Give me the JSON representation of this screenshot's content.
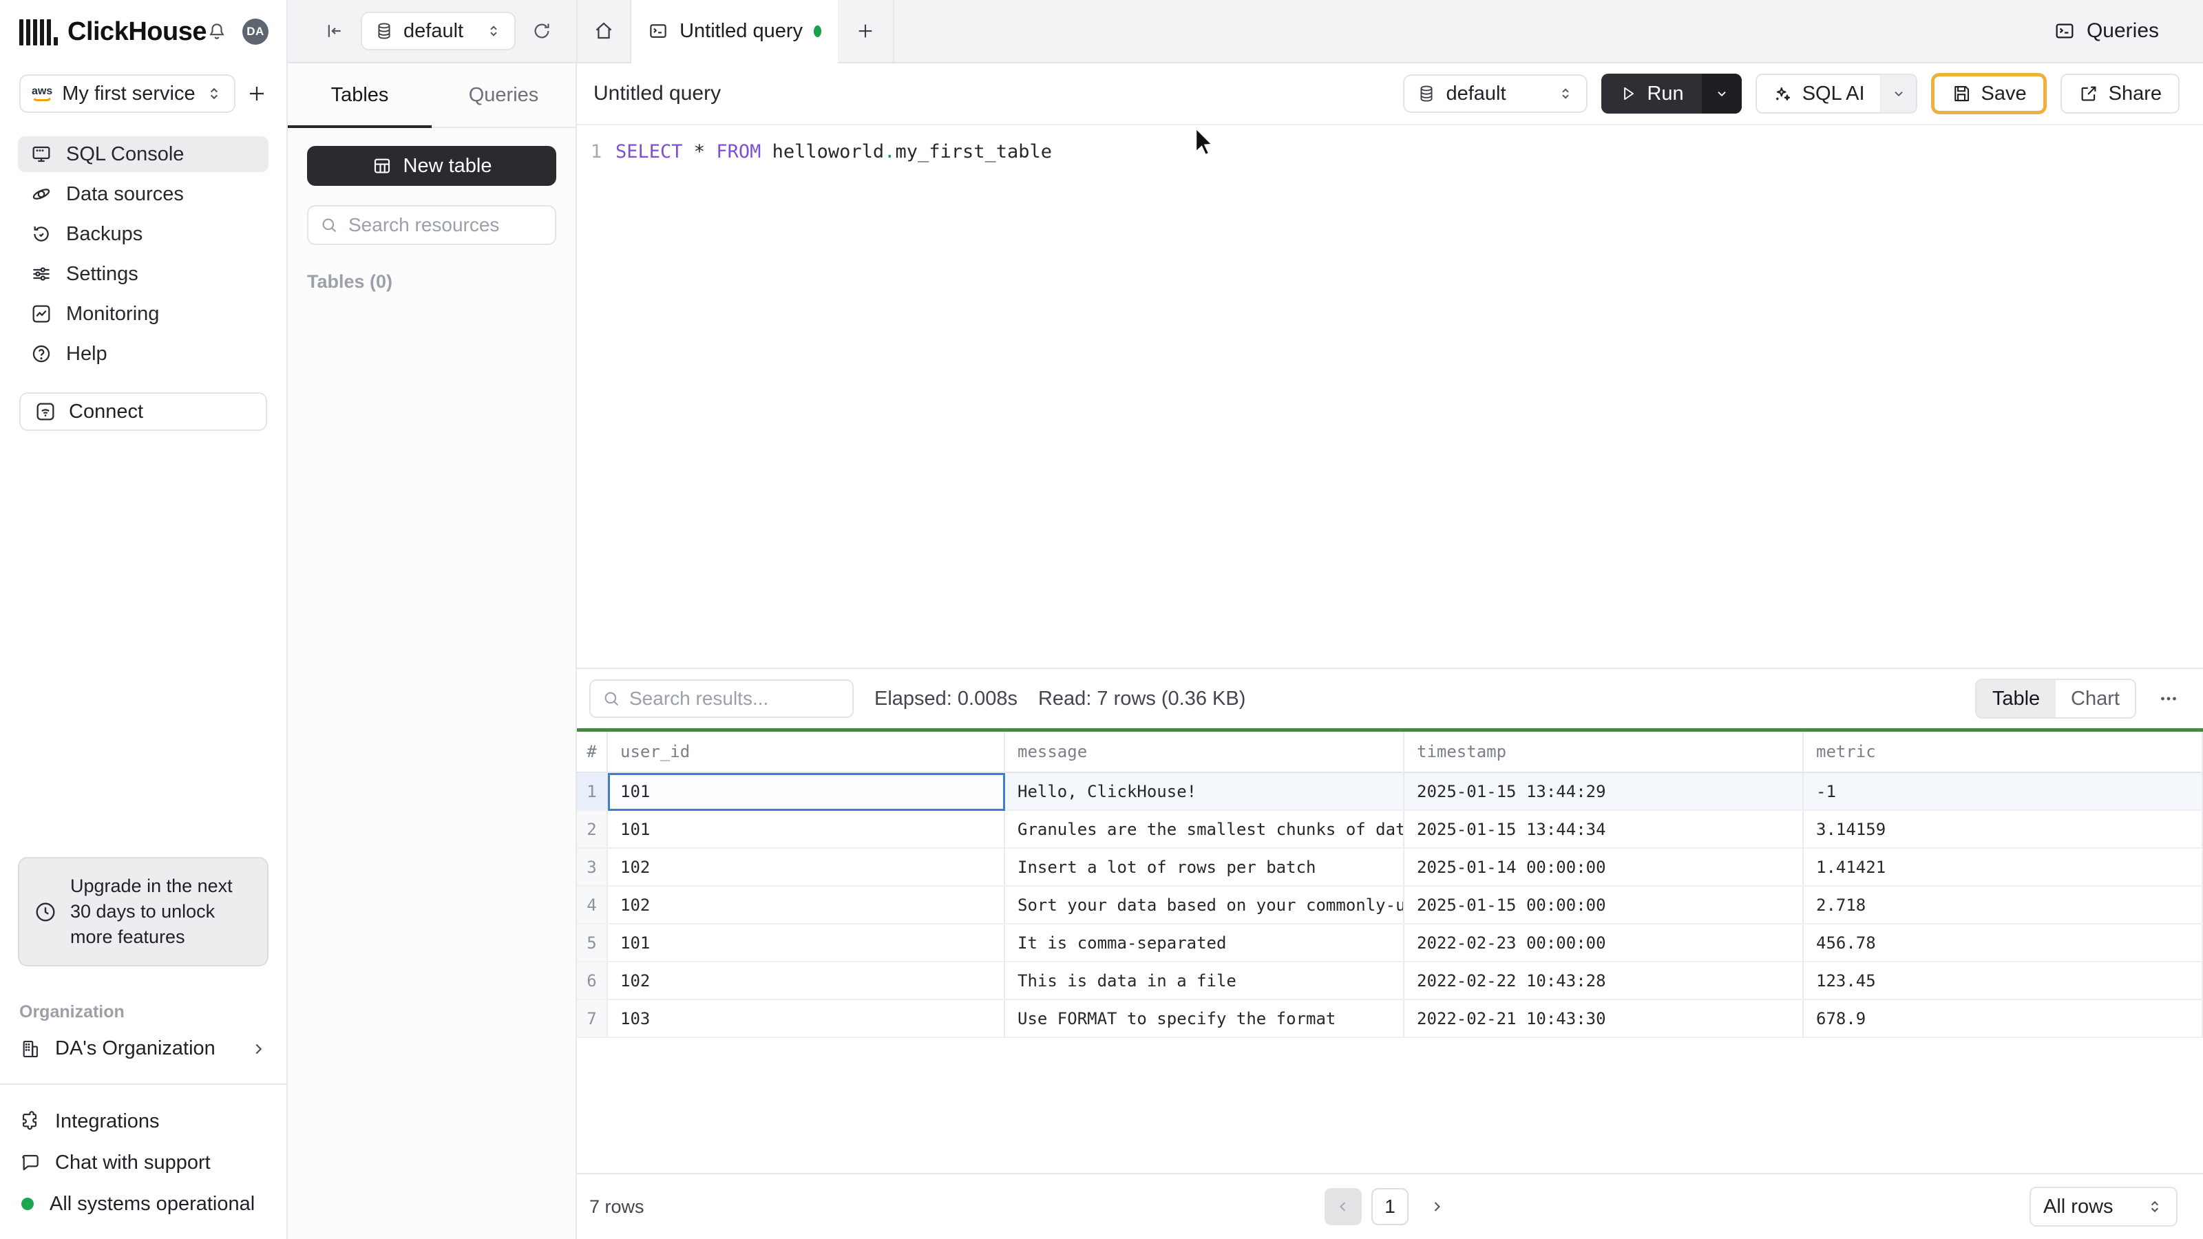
{
  "app": {
    "brand": "ClickHouse",
    "avatar_initials": "DA"
  },
  "topbar": {
    "database_selector": "default",
    "tab_title": "Untitled query",
    "queries_button": "Queries"
  },
  "sidebar": {
    "service_name": "My first service",
    "items": [
      {
        "label": "SQL Console",
        "icon": "sql-console-icon",
        "active": true
      },
      {
        "label": "Data sources",
        "icon": "data-sources-icon",
        "active": false
      },
      {
        "label": "Backups",
        "icon": "backups-icon",
        "active": false
      },
      {
        "label": "Settings",
        "icon": "settings-icon",
        "active": false
      },
      {
        "label": "Monitoring",
        "icon": "monitoring-icon",
        "active": false
      },
      {
        "label": "Help",
        "icon": "help-icon",
        "active": false
      }
    ],
    "connect_label": "Connect",
    "upgrade_notice": "Upgrade in the next 30 days to unlock more features",
    "organization_section": "Organization",
    "organization_name": "DA's Organization",
    "footer_items": [
      {
        "label": "Integrations",
        "icon": "puzzle-icon"
      },
      {
        "label": "Chat with support",
        "icon": "chat-icon"
      },
      {
        "label": "All systems operational",
        "icon": "status-dot"
      }
    ]
  },
  "resources_panel": {
    "tabs": [
      {
        "label": "Tables",
        "active": true
      },
      {
        "label": "Queries",
        "active": false
      }
    ],
    "new_table_label": "New table",
    "search_placeholder": "Search resources",
    "section_label": "Tables (0)"
  },
  "editor": {
    "title": "Untitled query",
    "line_number": "1",
    "sql": {
      "select": "SELECT",
      "star": " * ",
      "from": "FROM",
      "schema": " helloworld",
      "dot": ".",
      "table_name": "my_first_table"
    },
    "database_selector": "default",
    "run_label": "Run",
    "sql_ai_label": "SQL AI",
    "save_label": "Save",
    "share_label": "Share"
  },
  "results": {
    "search_placeholder": "Search results...",
    "elapsed": "Elapsed: 0.008s",
    "read": "Read: 7 rows (0.36 KB)",
    "view_toggle": [
      {
        "label": "Table",
        "active": true
      },
      {
        "label": "Chart",
        "active": false
      }
    ],
    "table": {
      "columns": [
        "#",
        "user_id",
        "message",
        "timestamp",
        "metric"
      ],
      "rows": [
        {
          "n": "1",
          "user_id": "101",
          "message": "Hello, ClickHouse!",
          "timestamp": "2025-01-15 13:44:29",
          "metric": "-1"
        },
        {
          "n": "2",
          "user_id": "101",
          "message": "Granules are the smallest chunks of data read",
          "timestamp": "2025-01-15 13:44:34",
          "metric": "3.14159"
        },
        {
          "n": "3",
          "user_id": "102",
          "message": "Insert a lot of rows per batch",
          "timestamp": "2025-01-14 00:00:00",
          "metric": "1.41421"
        },
        {
          "n": "4",
          "user_id": "102",
          "message": "Sort your data based on your commonly-used que…",
          "timestamp": "2025-01-15 00:00:00",
          "metric": "2.718"
        },
        {
          "n": "5",
          "user_id": "101",
          "message": "It is comma-separated",
          "timestamp": "2022-02-23 00:00:00",
          "metric": "456.78"
        },
        {
          "n": "6",
          "user_id": "102",
          "message": "This is data in a file",
          "timestamp": "2022-02-22 10:43:28",
          "metric": "123.45"
        },
        {
          "n": "7",
          "user_id": "103",
          "message": "Use FORMAT to specify the format",
          "timestamp": "2022-02-21 10:43:30",
          "metric": "678.9"
        }
      ]
    },
    "row_count": "7 rows",
    "page": "1",
    "page_size": "All rows",
    "colors": {
      "accent_green": "#478741",
      "selection_blue": "#3d7cd7",
      "save_highlight": "#f0b03e",
      "status_green": "#1da64d"
    }
  }
}
